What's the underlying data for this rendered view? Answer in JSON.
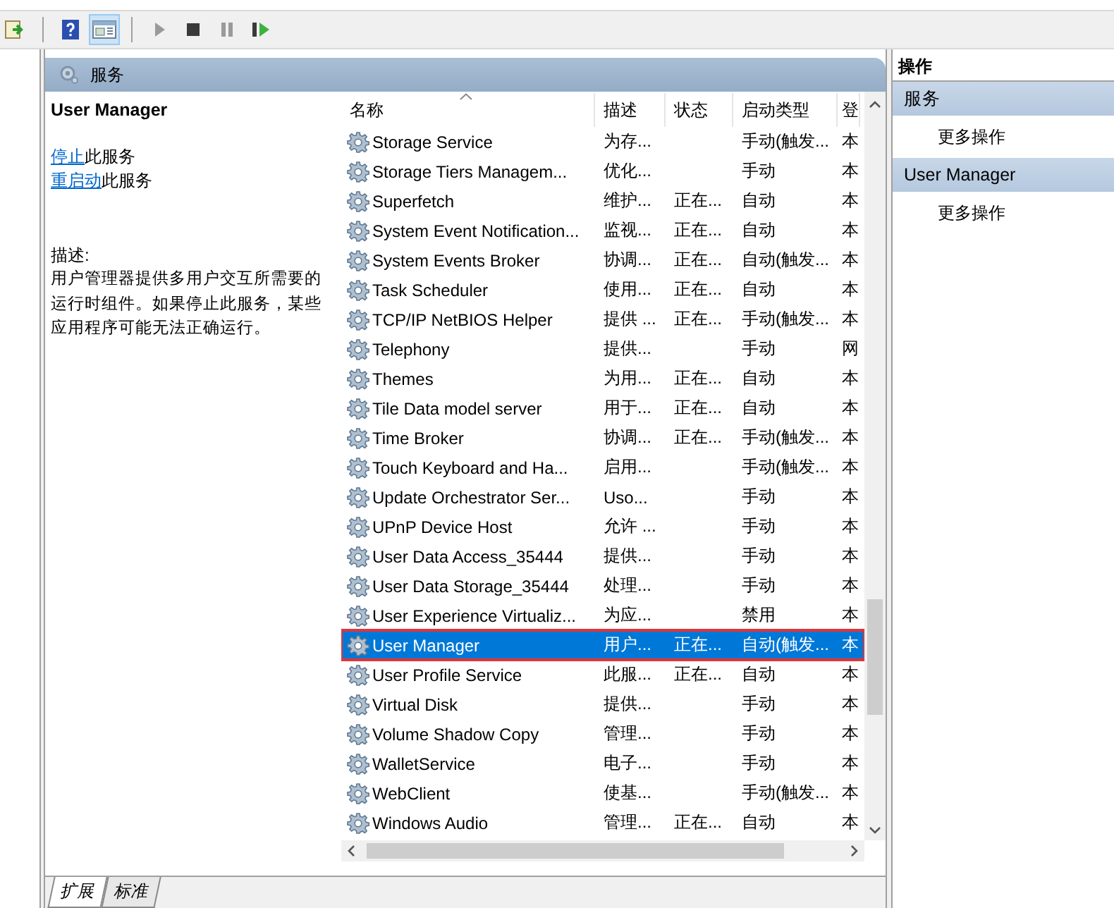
{
  "toolbar": [
    {
      "kind": "export",
      "pressed": false
    },
    {
      "kind": "help",
      "pressed": false
    },
    {
      "kind": "panel",
      "pressed": true
    },
    {
      "kind": "play",
      "pressed": false,
      "disabled": true
    },
    {
      "kind": "stop",
      "pressed": false,
      "disabled": false
    },
    {
      "kind": "pause",
      "pressed": false,
      "disabled": true
    },
    {
      "kind": "resume",
      "pressed": false,
      "disabled": false
    }
  ],
  "pane_title": "服务",
  "details": {
    "title": "User Manager",
    "actions": [
      {
        "link": "停止",
        "text": "此服务"
      },
      {
        "link": "重启动",
        "text": "此服务"
      }
    ],
    "description_label": "描述:",
    "description": "用户管理器提供多用户交互所需要的运行时组件。如果停止此服务，某些应用程序可能无法正确运行。"
  },
  "table": {
    "columns": [
      "名称",
      "描述",
      "状态",
      "启动类型",
      "登"
    ],
    "rows": [
      {
        "name": "Storage Service",
        "description": "为存...",
        "status": "",
        "startup": "手动(触发...",
        "logon": "本",
        "selected": false,
        "outlined": false
      },
      {
        "name": "Storage Tiers Managem...",
        "description": "优化...",
        "status": "",
        "startup": "手动",
        "logon": "本",
        "selected": false,
        "outlined": false
      },
      {
        "name": "Superfetch",
        "description": "维护...",
        "status": "正在...",
        "startup": "自动",
        "logon": "本",
        "selected": false,
        "outlined": false
      },
      {
        "name": "System Event Notification...",
        "description": "监视...",
        "status": "正在...",
        "startup": "自动",
        "logon": "本",
        "selected": false,
        "outlined": false
      },
      {
        "name": "System Events Broker",
        "description": "协调...",
        "status": "正在...",
        "startup": "自动(触发...",
        "logon": "本",
        "selected": false,
        "outlined": false
      },
      {
        "name": "Task Scheduler",
        "description": "使用...",
        "status": "正在...",
        "startup": "自动",
        "logon": "本",
        "selected": false,
        "outlined": false
      },
      {
        "name": "TCP/IP NetBIOS Helper",
        "description": "提供 ...",
        "status": "正在...",
        "startup": "手动(触发...",
        "logon": "本",
        "selected": false,
        "outlined": false
      },
      {
        "name": "Telephony",
        "description": "提供...",
        "status": "",
        "startup": "手动",
        "logon": "网",
        "selected": false,
        "outlined": false
      },
      {
        "name": "Themes",
        "description": "为用...",
        "status": "正在...",
        "startup": "自动",
        "logon": "本",
        "selected": false,
        "outlined": false
      },
      {
        "name": "Tile Data model server",
        "description": "用于...",
        "status": "正在...",
        "startup": "自动",
        "logon": "本",
        "selected": false,
        "outlined": false
      },
      {
        "name": "Time Broker",
        "description": "协调...",
        "status": "正在...",
        "startup": "手动(触发...",
        "logon": "本",
        "selected": false,
        "outlined": false
      },
      {
        "name": "Touch Keyboard and Ha...",
        "description": "启用...",
        "status": "",
        "startup": "手动(触发...",
        "logon": "本",
        "selected": false,
        "outlined": false
      },
      {
        "name": "Update Orchestrator Ser...",
        "description": "Uso...",
        "status": "",
        "startup": "手动",
        "logon": "本",
        "selected": false,
        "outlined": false
      },
      {
        "name": "UPnP Device Host",
        "description": "允许 ...",
        "status": "",
        "startup": "手动",
        "logon": "本",
        "selected": false,
        "outlined": false
      },
      {
        "name": "User Data Access_35444",
        "description": "提供...",
        "status": "",
        "startup": "手动",
        "logon": "本",
        "selected": false,
        "outlined": false
      },
      {
        "name": "User Data Storage_35444",
        "description": "处理...",
        "status": "",
        "startup": "手动",
        "logon": "本",
        "selected": false,
        "outlined": false
      },
      {
        "name": "User Experience Virtualiz...",
        "description": "为应...",
        "status": "",
        "startup": "禁用",
        "logon": "本",
        "selected": false,
        "outlined": false
      },
      {
        "name": "User Manager",
        "description": "用户...",
        "status": "正在...",
        "startup": "自动(触发...",
        "logon": "本",
        "selected": true,
        "outlined": true
      },
      {
        "name": "User Profile Service",
        "description": "此服...",
        "status": "正在...",
        "startup": "自动",
        "logon": "本",
        "selected": false,
        "outlined": false
      },
      {
        "name": "Virtual Disk",
        "description": "提供...",
        "status": "",
        "startup": "手动",
        "logon": "本",
        "selected": false,
        "outlined": false
      },
      {
        "name": "Volume Shadow Copy",
        "description": "管理...",
        "status": "",
        "startup": "手动",
        "logon": "本",
        "selected": false,
        "outlined": false
      },
      {
        "name": "WalletService",
        "description": "电子...",
        "status": "",
        "startup": "手动",
        "logon": "本",
        "selected": false,
        "outlined": false
      },
      {
        "name": "WebClient",
        "description": "使基...",
        "status": "",
        "startup": "手动(触发...",
        "logon": "本",
        "selected": false,
        "outlined": false
      },
      {
        "name": "Windows Audio",
        "description": "管理...",
        "status": "正在...",
        "startup": "自动",
        "logon": "本",
        "selected": false,
        "outlined": false
      }
    ]
  },
  "bottom_tabs": [
    {
      "label": "扩展",
      "selected": true
    },
    {
      "label": "标准",
      "selected": false
    }
  ],
  "actions_pane": {
    "title": "操作",
    "sections": [
      {
        "header": "服务",
        "items": [
          "更多操作"
        ]
      },
      {
        "header": "User Manager",
        "items": [
          "更多操作"
        ]
      }
    ]
  }
}
